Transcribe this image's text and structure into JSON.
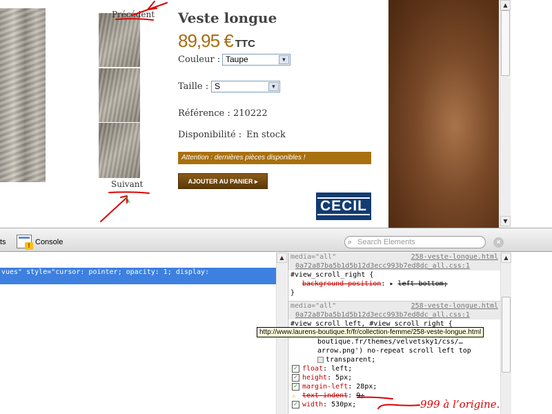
{
  "product": {
    "title": "Veste longue",
    "price": "89,95 €",
    "price_suffix": "TTC",
    "color_label": "Couleur :",
    "color_value": "Taupe",
    "size_label": "Taille :",
    "size_value": "S",
    "reference_label": "Référence :",
    "reference_value": "210222",
    "availability_label": "Disponibilité :",
    "availability_value": "En stock",
    "stock_warning": "Attention : dernières pièces disponibles !",
    "add_to_cart": "AJOUTER AU PANIER",
    "brand": "CECIL"
  },
  "thumbnails": {
    "prev_label": "Précédent",
    "next_label": "Suivant"
  },
  "devtools": {
    "tool_resources_label": "ts",
    "console_label": "Console",
    "search_placeholder": "Search Elements",
    "selected_node": "vues\" style=\"cursor: pointer; opacity: 1; display:",
    "rule1": {
      "media": "media=\"all\"",
      "source": "258-veste-longue.html",
      "source2": "0a72a87ba5b1d5b12d3ecc993b7ed8dc_all.css:1",
      "selector": "#view_scroll_right {",
      "prop1_name": "background-position",
      "prop1_value": "left bottom;"
    },
    "rule2": {
      "media": "media=\"all\"",
      "source": "258-veste-longue.html",
      "source2": "0a72a87ba5b1d5b12d3ecc993b7ed8dc_all.css:1",
      "selector": "#view_scroll_left, #view_scroll_right {",
      "bg_line1": "boutique.fr/themes/velvetsky1/css/…",
      "bg_line2": "arrow.png') no-repeat scroll left top",
      "bg_line3": "transparent;",
      "float_name": "float",
      "float_value": "left;",
      "height_name": "height",
      "height_value": "5px;",
      "margin_name": "margin-left",
      "margin_value": "28px;",
      "indent_name": "text-indent",
      "indent_value": "9;",
      "width_name": "width",
      "width_value": "530px;"
    },
    "tooltip_url": "http://www.laurens-boutique.fr/fr/collection-femme/258-veste-longue.html"
  },
  "annotation": {
    "note": "999 à l’origine.",
    "color": "#dd0000"
  },
  "colors": {
    "price": "#a86d12",
    "warning_bg": "#a8700f",
    "selection": "#3d80df",
    "brand_bg": "#123c72"
  }
}
